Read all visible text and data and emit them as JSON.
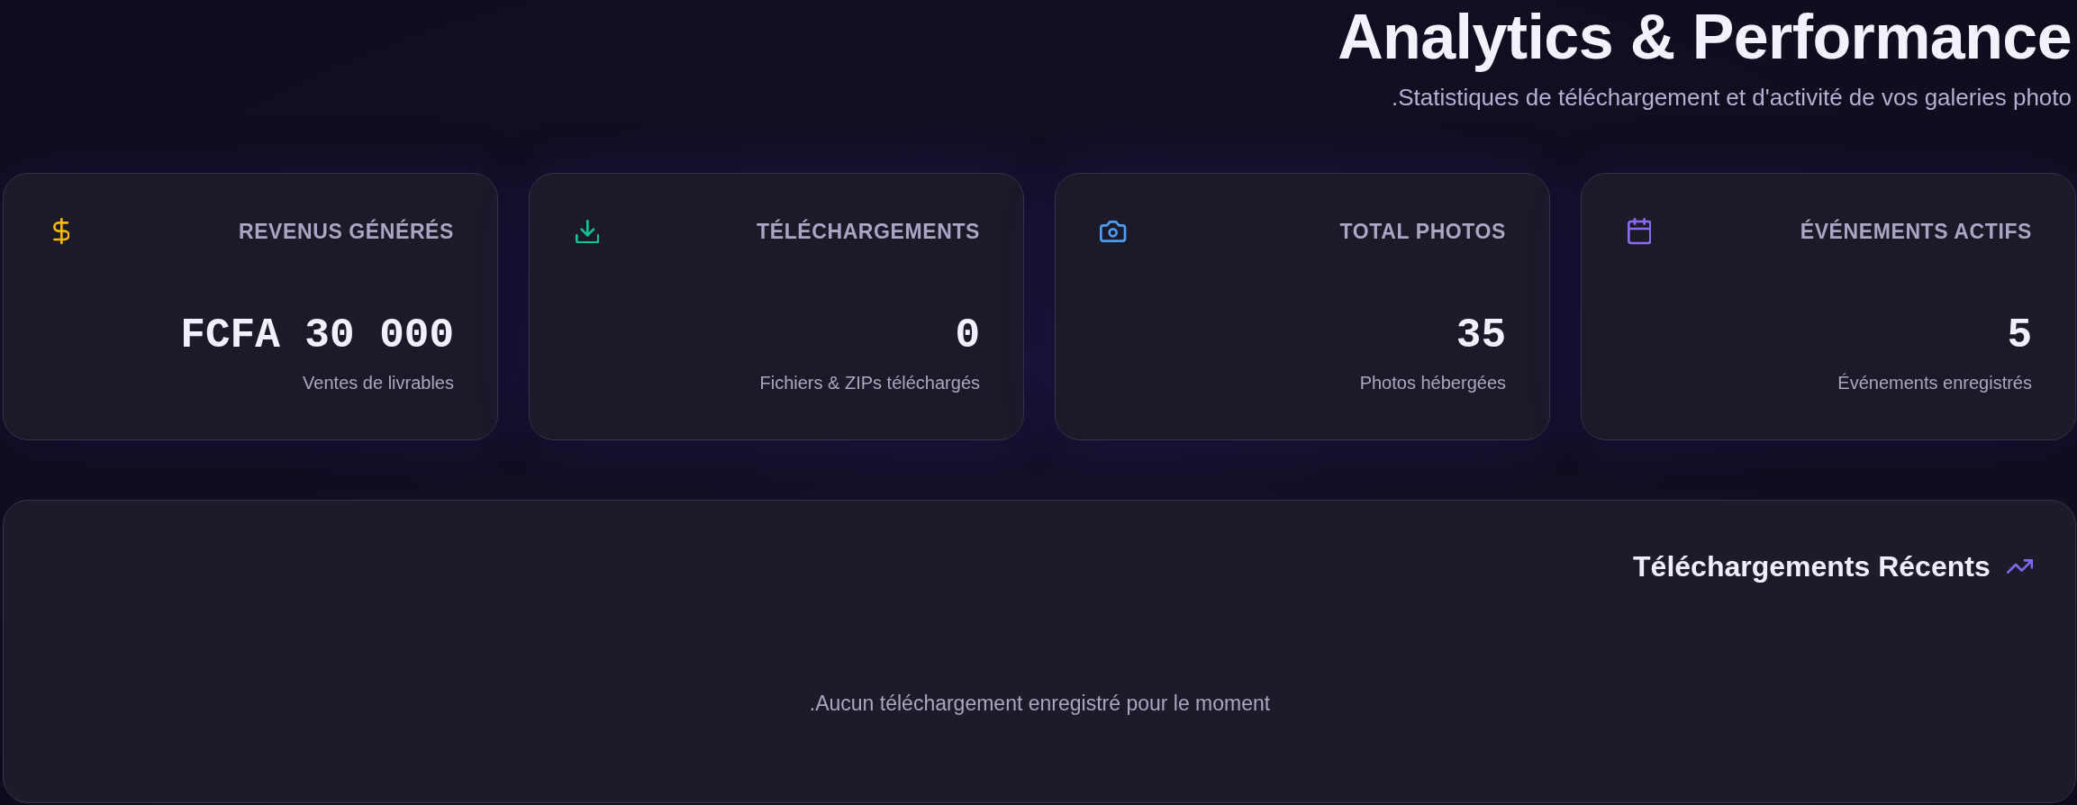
{
  "header": {
    "title": "Analytics & Performance",
    "subtitle": ".Statistiques de téléchargement et d'activité de vos galeries photo"
  },
  "stats": [
    {
      "kind": "revenue",
      "color": "#f5b40b",
      "label": "REVENUS GÉNÉRÉS",
      "value": "FCFA 30 000",
      "caption": "Ventes de livrables"
    },
    {
      "kind": "downloads",
      "color": "#12c497",
      "label": "TÉLÉCHARGEMENTS",
      "value": "0",
      "caption": "Fichiers & ZIPs téléchargés"
    },
    {
      "kind": "photos",
      "color": "#4d9df6",
      "label": "TOTAL PHOTOS",
      "value": "35",
      "caption": "Photos hébergées"
    },
    {
      "kind": "events",
      "color": "#8b6af6",
      "label": "ÉVÉNEMENTS ACTIFS",
      "value": "5",
      "caption": "Événements enregistrés"
    }
  ],
  "recent_downloads": {
    "title": "Téléchargements Récents",
    "empty_message": ".Aucun téléchargement enregistré pour le moment"
  }
}
